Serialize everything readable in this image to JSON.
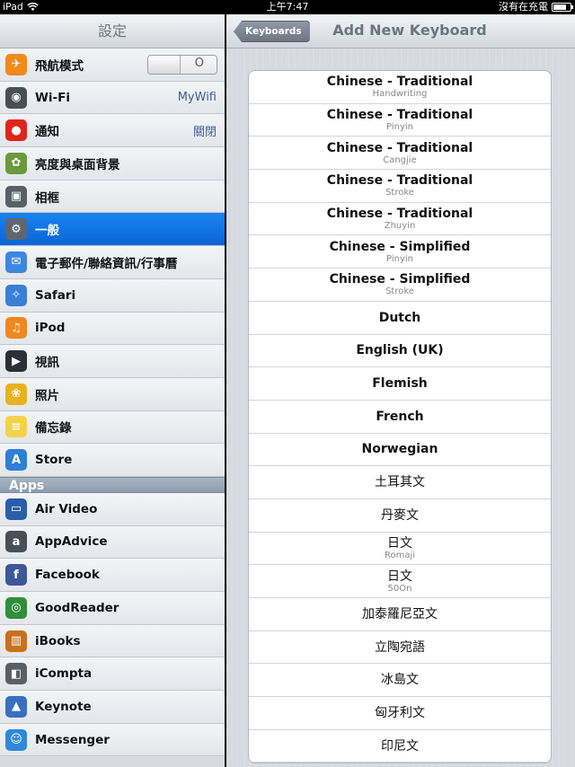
{
  "status_bar": {
    "device": "iPad",
    "time": "上午7:47",
    "charging": "沒有在充電"
  },
  "settings": {
    "title": "設定",
    "items": [
      {
        "label": "飛航模式",
        "icon": "airplane-icon",
        "color": "#f08a1c",
        "glyph": "✈",
        "toggle": "O"
      },
      {
        "label": "Wi-Fi",
        "icon": "wifi-icon",
        "color": "#4a4f57",
        "glyph": "◉",
        "value": "MyWifi"
      },
      {
        "label": "通知",
        "icon": "notifications-icon",
        "color": "#e0251c",
        "glyph": "●",
        "value": "關閉"
      },
      {
        "label": "亮度與桌面背景",
        "icon": "brightness-icon",
        "color": "#6a9a3c",
        "glyph": "✿"
      },
      {
        "label": "相框",
        "icon": "picture-frame-icon",
        "color": "#5a5f66",
        "glyph": "▣"
      },
      {
        "label": "一般",
        "icon": "gear-icon",
        "color": "#5f6670",
        "glyph": "⚙",
        "selected": true
      },
      {
        "label": "電子郵件/聯絡資訊/行事曆",
        "icon": "mail-icon",
        "color": "#3d87e0",
        "glyph": "✉"
      },
      {
        "label": "Safari",
        "icon": "safari-icon",
        "color": "#3a7fd8",
        "glyph": "✧"
      },
      {
        "label": "iPod",
        "icon": "ipod-icon",
        "color": "#f08820",
        "glyph": "♫"
      },
      {
        "label": "視訊",
        "icon": "video-icon",
        "color": "#2c2f35",
        "glyph": "▶"
      },
      {
        "label": "照片",
        "icon": "photos-icon",
        "color": "#e8b21e",
        "glyph": "❀"
      },
      {
        "label": "備忘錄",
        "icon": "notes-icon",
        "color": "#f2d24a",
        "glyph": "≡"
      },
      {
        "label": "Store",
        "icon": "store-icon",
        "color": "#2f7fd8",
        "glyph": "A"
      }
    ],
    "apps_header": "Apps",
    "apps": [
      {
        "label": "Air Video",
        "icon": "air-video-icon",
        "color": "#2a5ea8",
        "glyph": "▭"
      },
      {
        "label": "AppAdvice",
        "icon": "appadvice-icon",
        "color": "#4a4f57",
        "glyph": "a"
      },
      {
        "label": "Facebook",
        "icon": "facebook-icon",
        "color": "#3b5998",
        "glyph": "f"
      },
      {
        "label": "GoodReader",
        "icon": "goodreader-icon",
        "color": "#2f8f3a",
        "glyph": "◎"
      },
      {
        "label": "iBooks",
        "icon": "ibooks-icon",
        "color": "#c8701c",
        "glyph": "▥"
      },
      {
        "label": "iCompta",
        "icon": "icompta-icon",
        "color": "#5a5f66",
        "glyph": "◧"
      },
      {
        "label": "Keynote",
        "icon": "keynote-icon",
        "color": "#3a6fc0",
        "glyph": "▲"
      },
      {
        "label": "Messenger",
        "icon": "messenger-icon",
        "color": "#2f89d8",
        "glyph": "☺"
      }
    ]
  },
  "detail": {
    "back_label": "Keyboards",
    "title": "Add New Keyboard",
    "keyboards": [
      {
        "title": "Chinese - Traditional",
        "sub": "Handwriting"
      },
      {
        "title": "Chinese - Traditional",
        "sub": "Pinyin"
      },
      {
        "title": "Chinese - Traditional",
        "sub": "Cangjie"
      },
      {
        "title": "Chinese - Traditional",
        "sub": "Stroke"
      },
      {
        "title": "Chinese - Traditional",
        "sub": "Zhuyin"
      },
      {
        "title": "Chinese - Simplified",
        "sub": "Pinyin"
      },
      {
        "title": "Chinese - Simplified",
        "sub": "Stroke"
      },
      {
        "title": "Dutch",
        "sub": ""
      },
      {
        "title": "English (UK)",
        "sub": ""
      },
      {
        "title": "Flemish",
        "sub": ""
      },
      {
        "title": "French",
        "sub": ""
      },
      {
        "title": "Norwegian",
        "sub": ""
      },
      {
        "title": "土耳其文",
        "sub": "",
        "cjk": true
      },
      {
        "title": "丹麥文",
        "sub": "",
        "cjk": true
      },
      {
        "title": "日文",
        "sub": "Romaji",
        "cjk": true
      },
      {
        "title": "日文",
        "sub": "50On",
        "cjk": true
      },
      {
        "title": "加泰羅尼亞文",
        "sub": "",
        "cjk": true
      },
      {
        "title": "立陶宛語",
        "sub": "",
        "cjk": true
      },
      {
        "title": "冰島文",
        "sub": "",
        "cjk": true
      },
      {
        "title": "匈牙利文",
        "sub": "",
        "cjk": true
      },
      {
        "title": "印尼文",
        "sub": "",
        "cjk": true
      }
    ]
  }
}
